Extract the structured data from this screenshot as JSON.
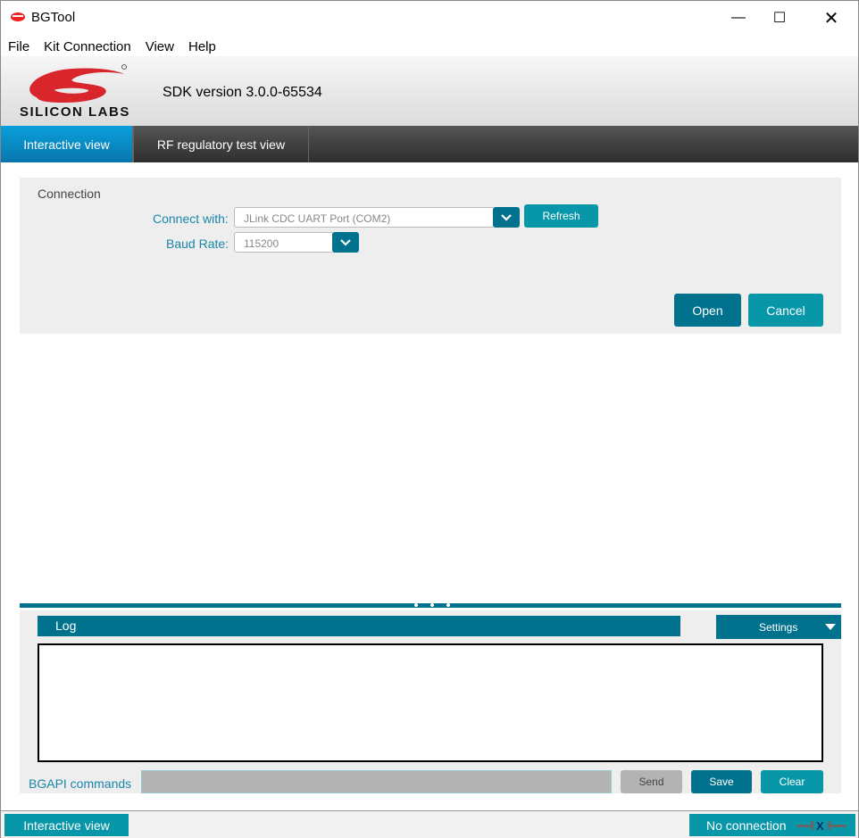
{
  "window": {
    "title": "BGTool"
  },
  "menu": [
    "File",
    "Kit Connection",
    "View",
    "Help"
  ],
  "header": {
    "logo_text": "SILICON LABS",
    "sdk_version": "SDK version 3.0.0-65534"
  },
  "tabs": [
    {
      "label": "Interactive view",
      "active": true
    },
    {
      "label": "RF regulatory test view",
      "active": false
    }
  ],
  "connection": {
    "title": "Connection",
    "connect_with_label": "Connect with:",
    "connect_with_value": "JLink CDC UART Port (COM2)",
    "refresh": "Refresh",
    "baud_label": "Baud Rate:",
    "baud_value": "115200",
    "open": "Open",
    "cancel": "Cancel"
  },
  "log": {
    "title": "Log",
    "settings": "Settings",
    "bgapi_label": "BGAPI commands",
    "bgapi_value": "",
    "send": "Send",
    "save": "Save",
    "clear": "Clear"
  },
  "status": {
    "view": "Interactive view",
    "connection": "No connection"
  },
  "colors": {
    "dark_teal": "#00728d",
    "teal": "#0897a8",
    "tab_active": "#0a8fcb"
  }
}
